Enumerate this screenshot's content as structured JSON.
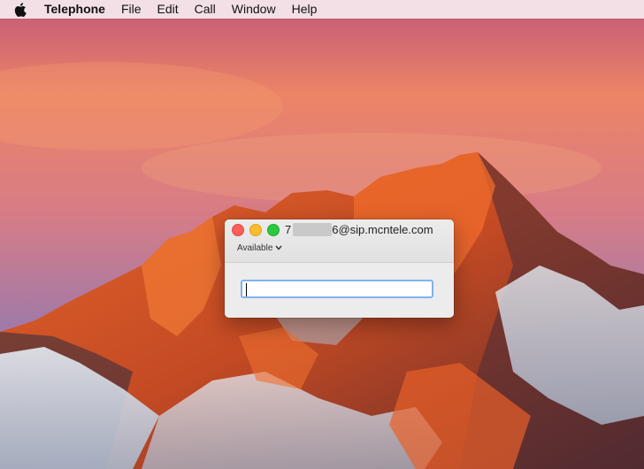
{
  "menubar": {
    "apple_icon": "apple-logo-icon",
    "app_name": "Telephone",
    "items": [
      "File",
      "Edit",
      "Call",
      "Window",
      "Help"
    ]
  },
  "window": {
    "account_prefix": "7",
    "account_suffix": "6@sip.mcntele.com",
    "status_label": "Available",
    "status_icon": "chevron-down-icon",
    "number_field": {
      "value": "",
      "placeholder": ""
    }
  },
  "colors": {
    "close": "#fc5f57",
    "minimize": "#fdbc2e",
    "zoom": "#2ac840",
    "focus_ring": "#7fb2ef"
  }
}
